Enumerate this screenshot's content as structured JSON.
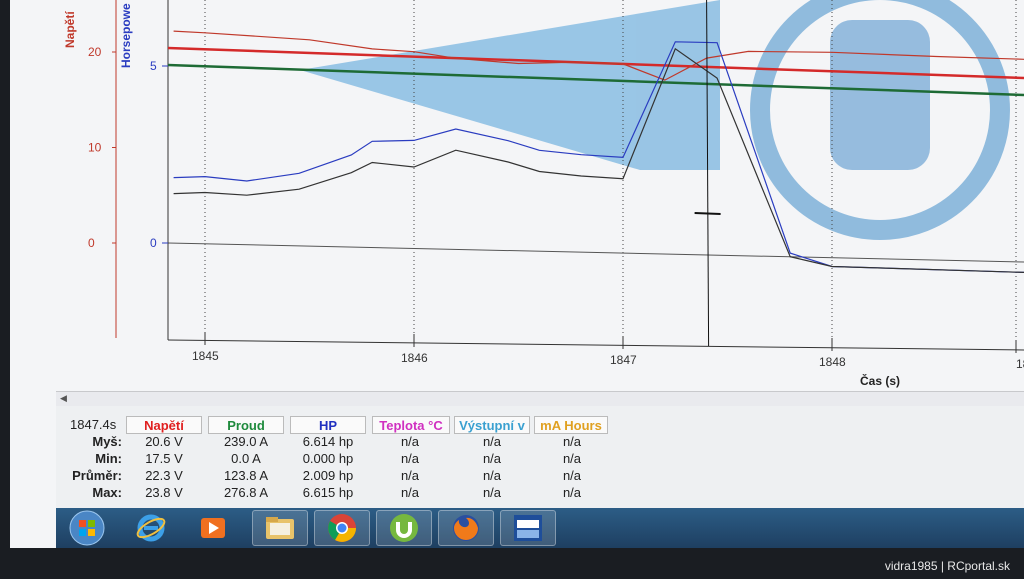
{
  "window": {
    "time_readout": "1847.4s"
  },
  "chart_data": {
    "type": "line",
    "xlabel": "Čas (s)",
    "x_ticks": [
      "1845",
      "1846",
      "1847",
      "1848",
      "18"
    ],
    "y_axes": [
      {
        "label": "Napětí",
        "color": "#c0392b",
        "ticks": [
          "20",
          "10",
          "0"
        ]
      },
      {
        "label": "Horsepowe",
        "color": "#2a3cc0",
        "ticks": [
          "5",
          "0"
        ]
      }
    ],
    "series": [
      {
        "name": "Napětí",
        "color": "#c0392b",
        "values": [
          [
            1844.85,
            22.2
          ],
          [
            1845.0,
            22.1
          ],
          [
            1845.5,
            21.6
          ],
          [
            1845.8,
            20.8
          ],
          [
            1846.0,
            20.6
          ],
          [
            1846.2,
            20.0
          ],
          [
            1846.5,
            19.6
          ],
          [
            1846.8,
            19.9
          ],
          [
            1847.0,
            19.8
          ],
          [
            1847.2,
            18.2
          ],
          [
            1847.4,
            20.6
          ],
          [
            1847.6,
            21.4
          ],
          [
            1848.0,
            21.5
          ],
          [
            1848.5,
            21.3
          ],
          [
            1848.95,
            21.2
          ]
        ]
      },
      {
        "name": "HP",
        "color": "#2a3cc0",
        "values": [
          [
            1844.85,
            1.85
          ],
          [
            1845.0,
            1.9
          ],
          [
            1845.2,
            1.8
          ],
          [
            1845.45,
            2.05
          ],
          [
            1845.7,
            2.6
          ],
          [
            1845.8,
            3.0
          ],
          [
            1846.0,
            3.05
          ],
          [
            1846.2,
            3.4
          ],
          [
            1846.45,
            3.1
          ],
          [
            1846.6,
            2.85
          ],
          [
            1846.8,
            2.75
          ],
          [
            1847.0,
            2.7
          ],
          [
            1847.25,
            6.0
          ],
          [
            1847.45,
            6.0
          ],
          [
            1847.8,
            0.1
          ],
          [
            1848.0,
            -0.25
          ],
          [
            1848.95,
            -0.3
          ]
        ]
      },
      {
        "name": "Proud",
        "color": "#333333",
        "values": [
          [
            1844.85,
            1.4
          ],
          [
            1845.0,
            1.45
          ],
          [
            1845.2,
            1.4
          ],
          [
            1845.45,
            1.6
          ],
          [
            1845.7,
            2.1
          ],
          [
            1845.8,
            2.4
          ],
          [
            1846.0,
            2.3
          ],
          [
            1846.2,
            2.8
          ],
          [
            1846.45,
            2.5
          ],
          [
            1846.6,
            2.25
          ],
          [
            1846.8,
            2.15
          ],
          [
            1847.0,
            2.1
          ],
          [
            1847.25,
            5.8
          ],
          [
            1847.45,
            5.0
          ],
          [
            1847.8,
            0.0
          ],
          [
            1848.0,
            -0.25
          ],
          [
            1848.95,
            -0.3
          ]
        ]
      }
    ],
    "reference_lines": [
      {
        "name": "Napětí-avg",
        "color": "#d42a2a"
      },
      {
        "name": "HP-avg",
        "color": "#1e6b35"
      }
    ]
  },
  "stats": {
    "headers": [
      {
        "label": "Napětí",
        "color": "#e02020"
      },
      {
        "label": "Proud",
        "color": "#1e8a3c"
      },
      {
        "label": "HP",
        "color": "#2030c0"
      },
      {
        "label": "Teplota °C",
        "color": "#d030c0"
      },
      {
        "label": "Výstupní v",
        "color": "#3aa0d0"
      },
      {
        "label": "mA Hours",
        "color": "#e0a020"
      }
    ],
    "rows": [
      {
        "label": "Myš:",
        "values": [
          "20.6 V",
          "239.0 A",
          "6.614 hp",
          "n/a",
          "n/a",
          "n/a"
        ]
      },
      {
        "label": "Min:",
        "values": [
          "17.5 V",
          "0.0 A",
          "0.000 hp",
          "n/a",
          "n/a",
          "n/a"
        ]
      },
      {
        "label": "Průměr:",
        "values": [
          "22.3 V",
          "123.8 A",
          "2.009 hp",
          "n/a",
          "n/a",
          "n/a"
        ]
      },
      {
        "label": "Max:",
        "values": [
          "23.8 V",
          "276.8 A",
          "6.615 hp",
          "n/a",
          "n/a",
          "n/a"
        ]
      }
    ]
  },
  "taskbar": {
    "icons": [
      "windows-start-icon",
      "internet-explorer-icon",
      "media-player-icon",
      "file-explorer-icon",
      "chrome-icon",
      "utorrent-icon",
      "firefox-icon",
      "castle-link-icon"
    ]
  },
  "watermark": "vidra1985 | RCportal.sk"
}
